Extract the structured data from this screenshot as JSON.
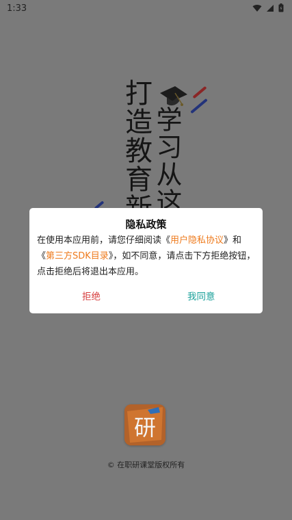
{
  "status_bar": {
    "time": "1:33"
  },
  "splash": {
    "slogan_line1": "打造教育新",
    "slogan_line2": "学习从这"
  },
  "dialog": {
    "title": "隐私政策",
    "body_1": "在使用本应用前，请您仔细阅读《",
    "link_1": "用户隐私协议",
    "body_2": "》和《",
    "link_2": "第三方SDK目录",
    "body_3": "》，如不同意，请点击下方拒绝按钮，点击拒绝后将退出本应用。",
    "reject_label": "拒绝",
    "agree_label": "我同意"
  },
  "footer": {
    "logo_char": "研",
    "copyright": "© 在职研课堂版权所有"
  },
  "colors": {
    "overlay": "#7a7a7a",
    "link": "#ee7a1c",
    "reject": "#d63d3d",
    "agree": "#1aa09a"
  },
  "icons": [
    "wifi-icon",
    "signal-icon",
    "battery-icon",
    "graduation-cap-icon",
    "app-logo-icon"
  ]
}
